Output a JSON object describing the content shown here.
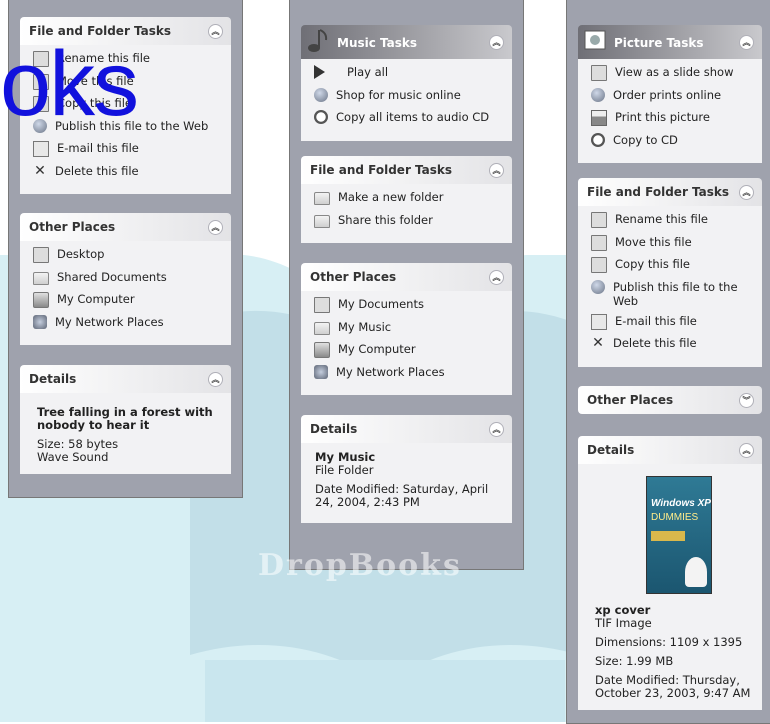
{
  "watermark": {
    "text": "oks",
    "brand": "DropBooks"
  },
  "column1": {
    "file_tasks": {
      "title": "File and Folder Tasks",
      "items": [
        {
          "label": "Rename this file",
          "icon": "rename-icon"
        },
        {
          "label": "Move this file",
          "icon": "move-icon"
        },
        {
          "label": "Copy this file",
          "icon": "copy-icon"
        },
        {
          "label": "Publish this file to the Web",
          "icon": "publish-icon"
        },
        {
          "label": "E-mail this file",
          "icon": "email-icon"
        },
        {
          "label": "Delete this file",
          "icon": "delete-icon"
        }
      ]
    },
    "other_places": {
      "title": "Other Places",
      "items": [
        {
          "label": "Desktop",
          "icon": "desktop-icon"
        },
        {
          "label": "Shared Documents",
          "icon": "folder-icon"
        },
        {
          "label": "My Computer",
          "icon": "computer-icon"
        },
        {
          "label": "My Network Places",
          "icon": "network-icon"
        }
      ]
    },
    "details": {
      "title": "Details",
      "name": "Tree falling in a forest with nobody to hear it",
      "size": "Size: 58 bytes",
      "type": "Wave Sound"
    }
  },
  "column2": {
    "music_tasks": {
      "title": "Music Tasks",
      "items": [
        {
          "label": "Play all",
          "icon": "play-icon"
        },
        {
          "label": "Shop for music online",
          "icon": "globe-icon"
        },
        {
          "label": "Copy all items to audio CD",
          "icon": "cd-icon"
        }
      ]
    },
    "file_tasks": {
      "title": "File and Folder Tasks",
      "items": [
        {
          "label": "Make a new folder",
          "icon": "new-folder-icon"
        },
        {
          "label": "Share this folder",
          "icon": "share-folder-icon"
        }
      ]
    },
    "other_places": {
      "title": "Other Places",
      "items": [
        {
          "label": "My Documents",
          "icon": "documents-icon"
        },
        {
          "label": "My Music",
          "icon": "folder-icon"
        },
        {
          "label": "My Computer",
          "icon": "computer-icon"
        },
        {
          "label": "My Network Places",
          "icon": "network-icon"
        }
      ]
    },
    "details": {
      "title": "Details",
      "name": "My Music",
      "type": "File Folder",
      "modified": "Date Modified: Saturday, April 24, 2004, 2:43 PM"
    }
  },
  "column3": {
    "picture_tasks": {
      "title": "Picture Tasks",
      "items": [
        {
          "label": "View as a slide show",
          "icon": "slideshow-icon"
        },
        {
          "label": "Order prints online",
          "icon": "order-prints-icon"
        },
        {
          "label": "Print this picture",
          "icon": "printer-icon"
        },
        {
          "label": "Copy to CD",
          "icon": "cd-icon"
        }
      ]
    },
    "file_tasks": {
      "title": "File and Folder Tasks",
      "items": [
        {
          "label": "Rename this file",
          "icon": "rename-icon"
        },
        {
          "label": "Move this file",
          "icon": "move-icon"
        },
        {
          "label": "Copy this file",
          "icon": "copy-icon"
        },
        {
          "label": "Publish this file to the Web",
          "icon": "publish-icon"
        },
        {
          "label": "E-mail this file",
          "icon": "email-icon"
        },
        {
          "label": "Delete this file",
          "icon": "delete-icon"
        }
      ]
    },
    "other_places": {
      "title": "Other Places"
    },
    "details": {
      "title": "Details",
      "thumb": {
        "line1": "Windows XP",
        "line2": "DUMMIES"
      },
      "name": "xp cover",
      "type": "TIF Image",
      "dimensions": "Dimensions: 1109 x 1395",
      "size": "Size: 1.99 MB",
      "modified": "Date Modified: Thursday, October 23, 2003, 9:47 AM"
    }
  }
}
